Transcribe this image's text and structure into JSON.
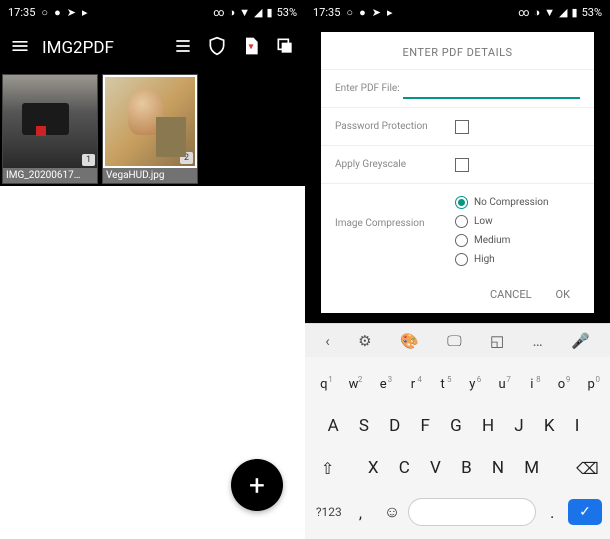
{
  "statusbar": {
    "time": "17:35",
    "battery": "53%"
  },
  "appbar": {
    "title": "IMG2PDF"
  },
  "thumbs": [
    {
      "label": "IMG_20200617…",
      "badge": "1"
    },
    {
      "label": "VegaHUD.jpg",
      "badge": "2"
    }
  ],
  "dialog": {
    "title": "ENTER PDF DETAILS",
    "file_label": "Enter PDF File:",
    "password_label": "Password Protection",
    "greyscale_label": "Apply Greyscale",
    "compression_label": "Image Compression",
    "compression_options": [
      "No Compression",
      "Low",
      "Medium",
      "High"
    ],
    "cancel": "CANCEL",
    "ok": "OK"
  },
  "keyboard": {
    "row1": [
      "q",
      "w",
      "e",
      "r",
      "t",
      "y",
      "u",
      "i",
      "o",
      "p"
    ],
    "nums": [
      "1",
      "2",
      "3",
      "4",
      "5",
      "6",
      "7",
      "8",
      "9",
      "0"
    ],
    "row2": "A S D F G H J K I",
    "row3": "X C V B N M",
    "sym": "?123"
  }
}
